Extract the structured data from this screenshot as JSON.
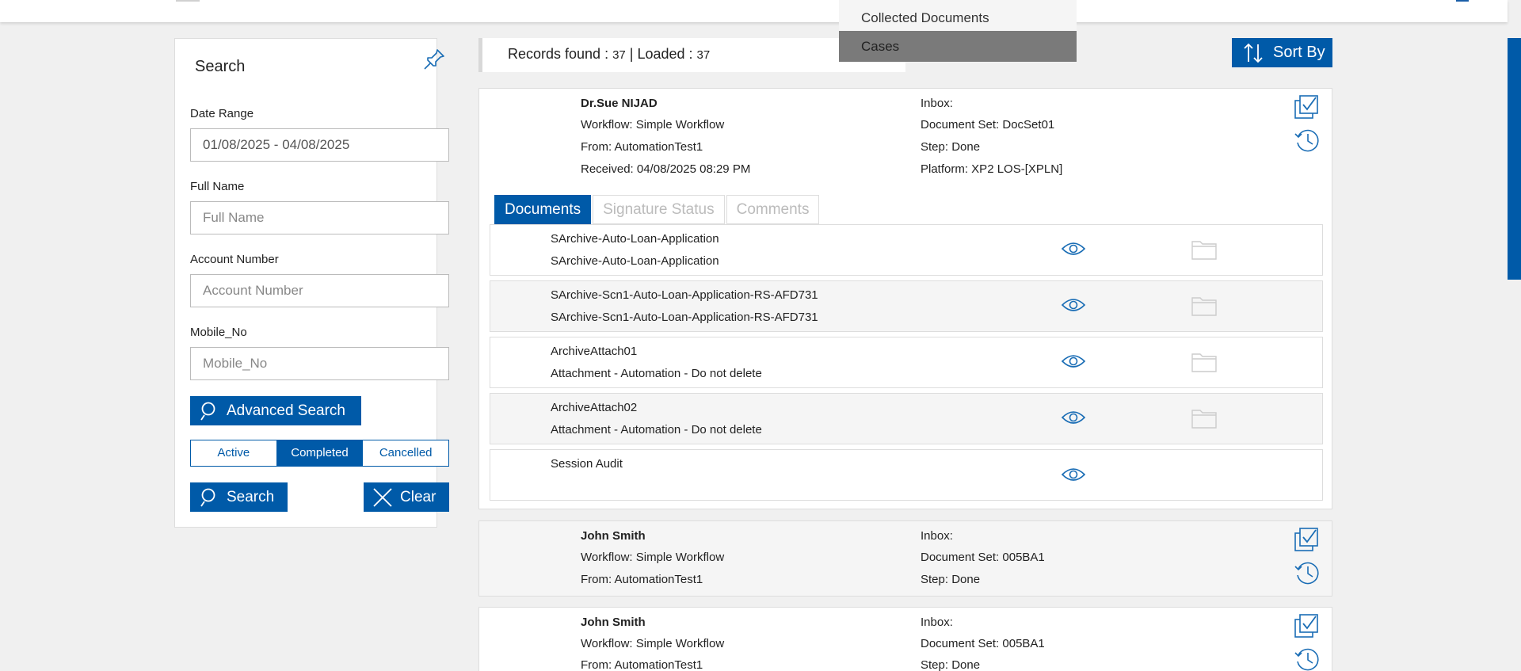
{
  "dropdown": {
    "items": [
      {
        "label": "Collected Documents",
        "active": false
      },
      {
        "label": "Cases",
        "active": true
      }
    ]
  },
  "search_panel": {
    "title": "Search",
    "date_range_label": "Date Range",
    "date_range_value": "01/08/2025 - 04/08/2025",
    "full_name_label": "Full Name",
    "full_name_placeholder": "Full Name",
    "account_number_label": "Account Number",
    "account_number_placeholder": "Account Number",
    "mobile_label": "Mobile_No",
    "mobile_placeholder": "Mobile_No",
    "advanced_search_label": "Advanced Search",
    "status_tabs": [
      "Active",
      "Completed",
      "Cancelled"
    ],
    "selected_status": "Completed",
    "search_label": "Search",
    "clear_label": "Clear"
  },
  "records": {
    "found_label": "Records found : ",
    "found_count": "37",
    "loaded_label": " | Loaded : ",
    "loaded_count": "37"
  },
  "sort_by_label": "Sort By",
  "cards": [
    {
      "name": "Dr.Sue NIJAD",
      "workflow": "Workflow: Simple Workflow",
      "from": "From: AutomationTest1",
      "received": "Received: 04/08/2025 08:29 PM",
      "inbox": "Inbox:",
      "document_set": "Document Set: DocSet01",
      "step": "Step: Done",
      "platform": "Platform: XP2 LOS-[XPLN]",
      "tabs": [
        "Documents",
        "Signature Status",
        "Comments"
      ],
      "documents": [
        {
          "title": "SArchive-Auto-Loan-Application",
          "subtitle": "SArchive-Auto-Loan-Application"
        },
        {
          "title": "SArchive-Scn1-Auto-Loan-Application-RS-AFD731",
          "subtitle": "SArchive-Scn1-Auto-Loan-Application-RS-AFD731"
        },
        {
          "title": "ArchiveAttach01",
          "subtitle": "Attachment - Automation - Do not delete"
        },
        {
          "title": "ArchiveAttach02",
          "subtitle": "Attachment - Automation - Do not delete"
        },
        {
          "title": "Session Audit",
          "subtitle": ""
        }
      ]
    },
    {
      "name": "John Smith",
      "workflow": "Workflow: Simple Workflow",
      "from": "From: AutomationTest1",
      "inbox": "Inbox:",
      "document_set": "Document Set: 005BA1",
      "step": "Step: Done"
    },
    {
      "name": "John Smith",
      "workflow": "Workflow: Simple Workflow",
      "from": "From: AutomationTest1",
      "inbox": "Inbox:",
      "document_set": "Document Set: 005BA1",
      "step": "Step: Done"
    }
  ],
  "colors": {
    "accent": "#005aa8",
    "panel_bg": "#ffffff",
    "page_bg": "#f0f0f0"
  }
}
